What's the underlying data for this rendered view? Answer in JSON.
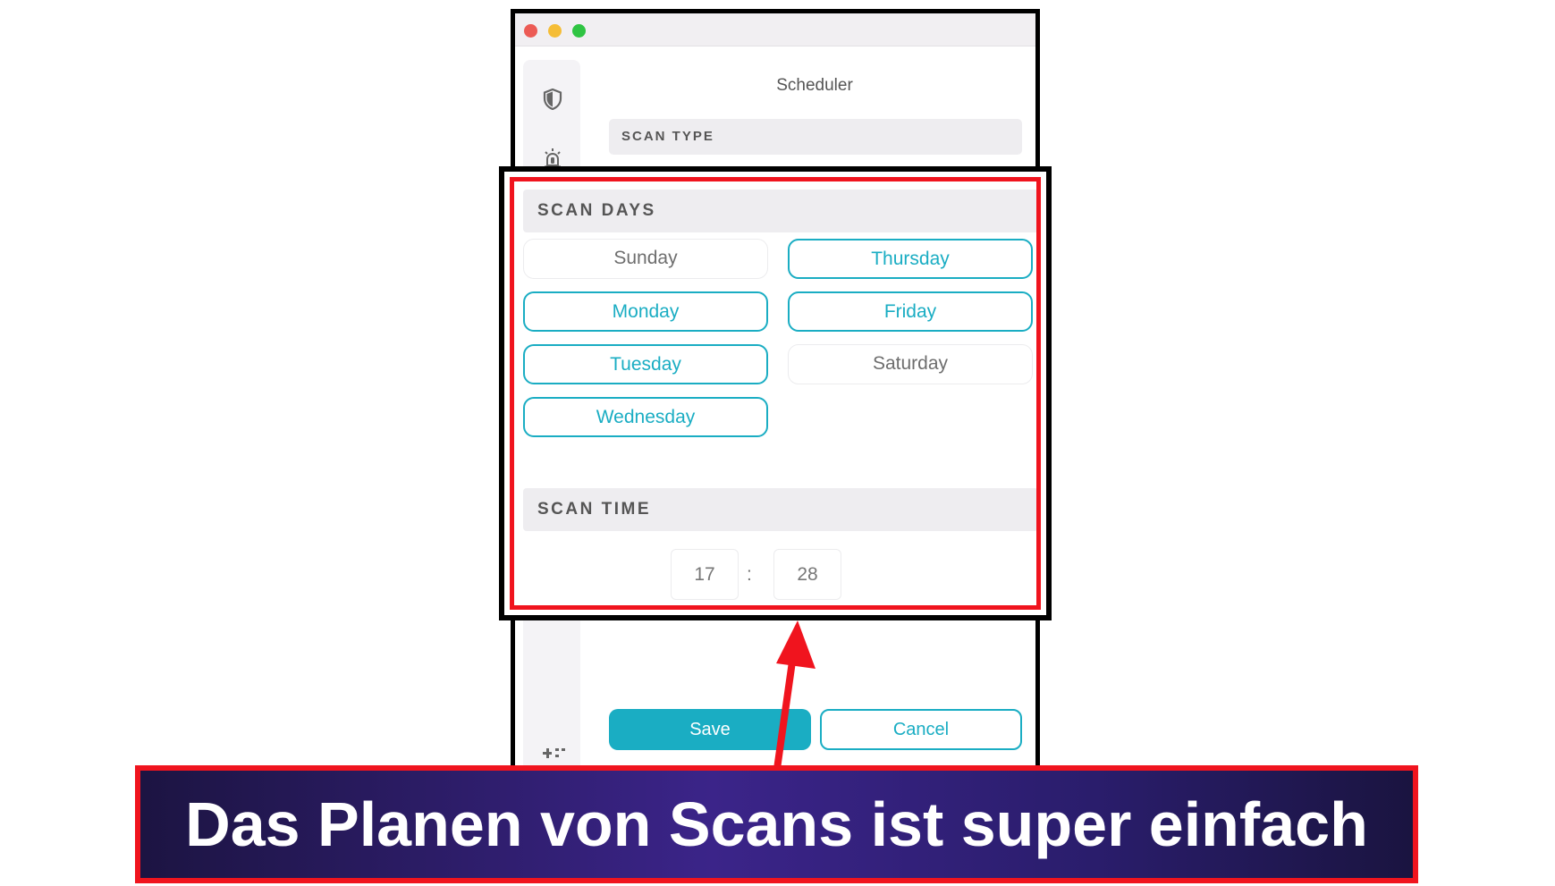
{
  "window": {
    "title": "Scheduler"
  },
  "scan_type": {
    "header": "SCAN TYPE"
  },
  "scan_days": {
    "header": "SCAN DAYS",
    "days": [
      {
        "label": "Sunday",
        "selected": false
      },
      {
        "label": "Monday",
        "selected": true
      },
      {
        "label": "Tuesday",
        "selected": true
      },
      {
        "label": "Wednesday",
        "selected": true
      },
      {
        "label": "Thursday",
        "selected": true
      },
      {
        "label": "Friday",
        "selected": true
      },
      {
        "label": "Saturday",
        "selected": false
      }
    ]
  },
  "scan_time": {
    "header": "SCAN TIME",
    "hour": "17",
    "separator": ":",
    "minute": "28"
  },
  "actions": {
    "save_label": "Save",
    "cancel_label": "Cancel"
  },
  "caption": {
    "text": "Das Planen von Scans ist super einfach"
  },
  "icons": {
    "sidebar": [
      "shield-icon",
      "alarm-icon",
      "settings-icon"
    ]
  },
  "colors": {
    "accent": "#1aadc3",
    "highlight": "#f0141e",
    "banner_bg": "#2a1d6c",
    "traffic_red": "#ec5b55",
    "traffic_yellow": "#f5bd36",
    "traffic_green": "#2fc443"
  }
}
